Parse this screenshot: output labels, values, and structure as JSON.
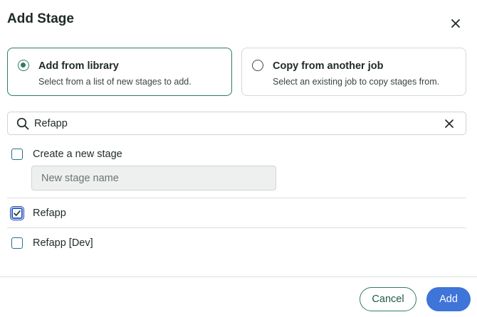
{
  "dialog": {
    "title": "Add Stage"
  },
  "options": [
    {
      "title": "Add from library",
      "description": "Select from a list of new stages to add.",
      "selected": true
    },
    {
      "title": "Copy from another job",
      "description": "Select an existing job to copy stages from.",
      "selected": false
    }
  ],
  "search": {
    "value": "Refapp"
  },
  "create_stage": {
    "label": "Create a new stage",
    "checked": false,
    "input_placeholder": "New stage name"
  },
  "stages": [
    {
      "label": "Refapp",
      "checked": true
    },
    {
      "label": "Refapp [Dev]",
      "checked": false
    }
  ],
  "footer": {
    "cancel_label": "Cancel",
    "add_label": "Add"
  },
  "colors": {
    "accent_green": "#2e7d62",
    "primary_blue": "#3f74d9"
  },
  "icons": [
    "close-icon",
    "search-icon",
    "clear-icon",
    "checkmark-icon"
  ]
}
